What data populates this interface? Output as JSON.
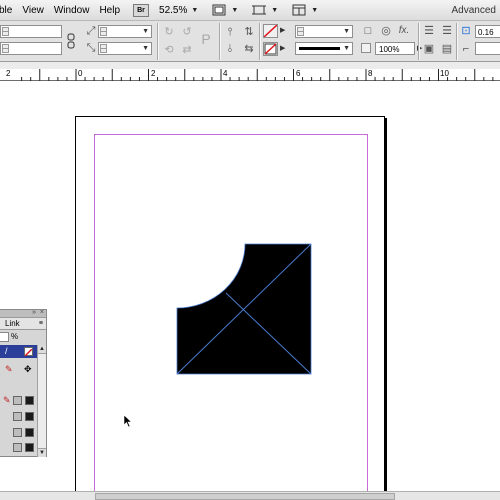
{
  "menubar": {
    "items": [
      "ble",
      "View",
      "Window",
      "Help"
    ],
    "bridge_badge": "Br",
    "zoom": "52.5%",
    "workspace": "Advanced"
  },
  "control_panel": {
    "stroke_weight_value": "0.16",
    "percent_value": "100%",
    "icons": [
      "rotate-cw-icon",
      "rotate-ccw-icon",
      "type-on-path-icon",
      "flip-horizontal-icon",
      "flip-vertical-icon",
      "fx-icon",
      "align-left-icon",
      "align-center-icon",
      "fit-frame-icon"
    ]
  },
  "ruler": {
    "labels": [
      "2",
      "0",
      "2",
      "4",
      "6",
      "8",
      "10"
    ]
  },
  "swatches_panel": {
    "tab_label": "Link",
    "tint_unit": "%",
    "collapse_glyph": "»",
    "close_glyph": "×",
    "menu_glyph": "≡"
  },
  "document": {
    "shape_fill": "#000000",
    "frame_line_color": "#4a7bd0",
    "margin_guide_color": "#c86bd8"
  }
}
